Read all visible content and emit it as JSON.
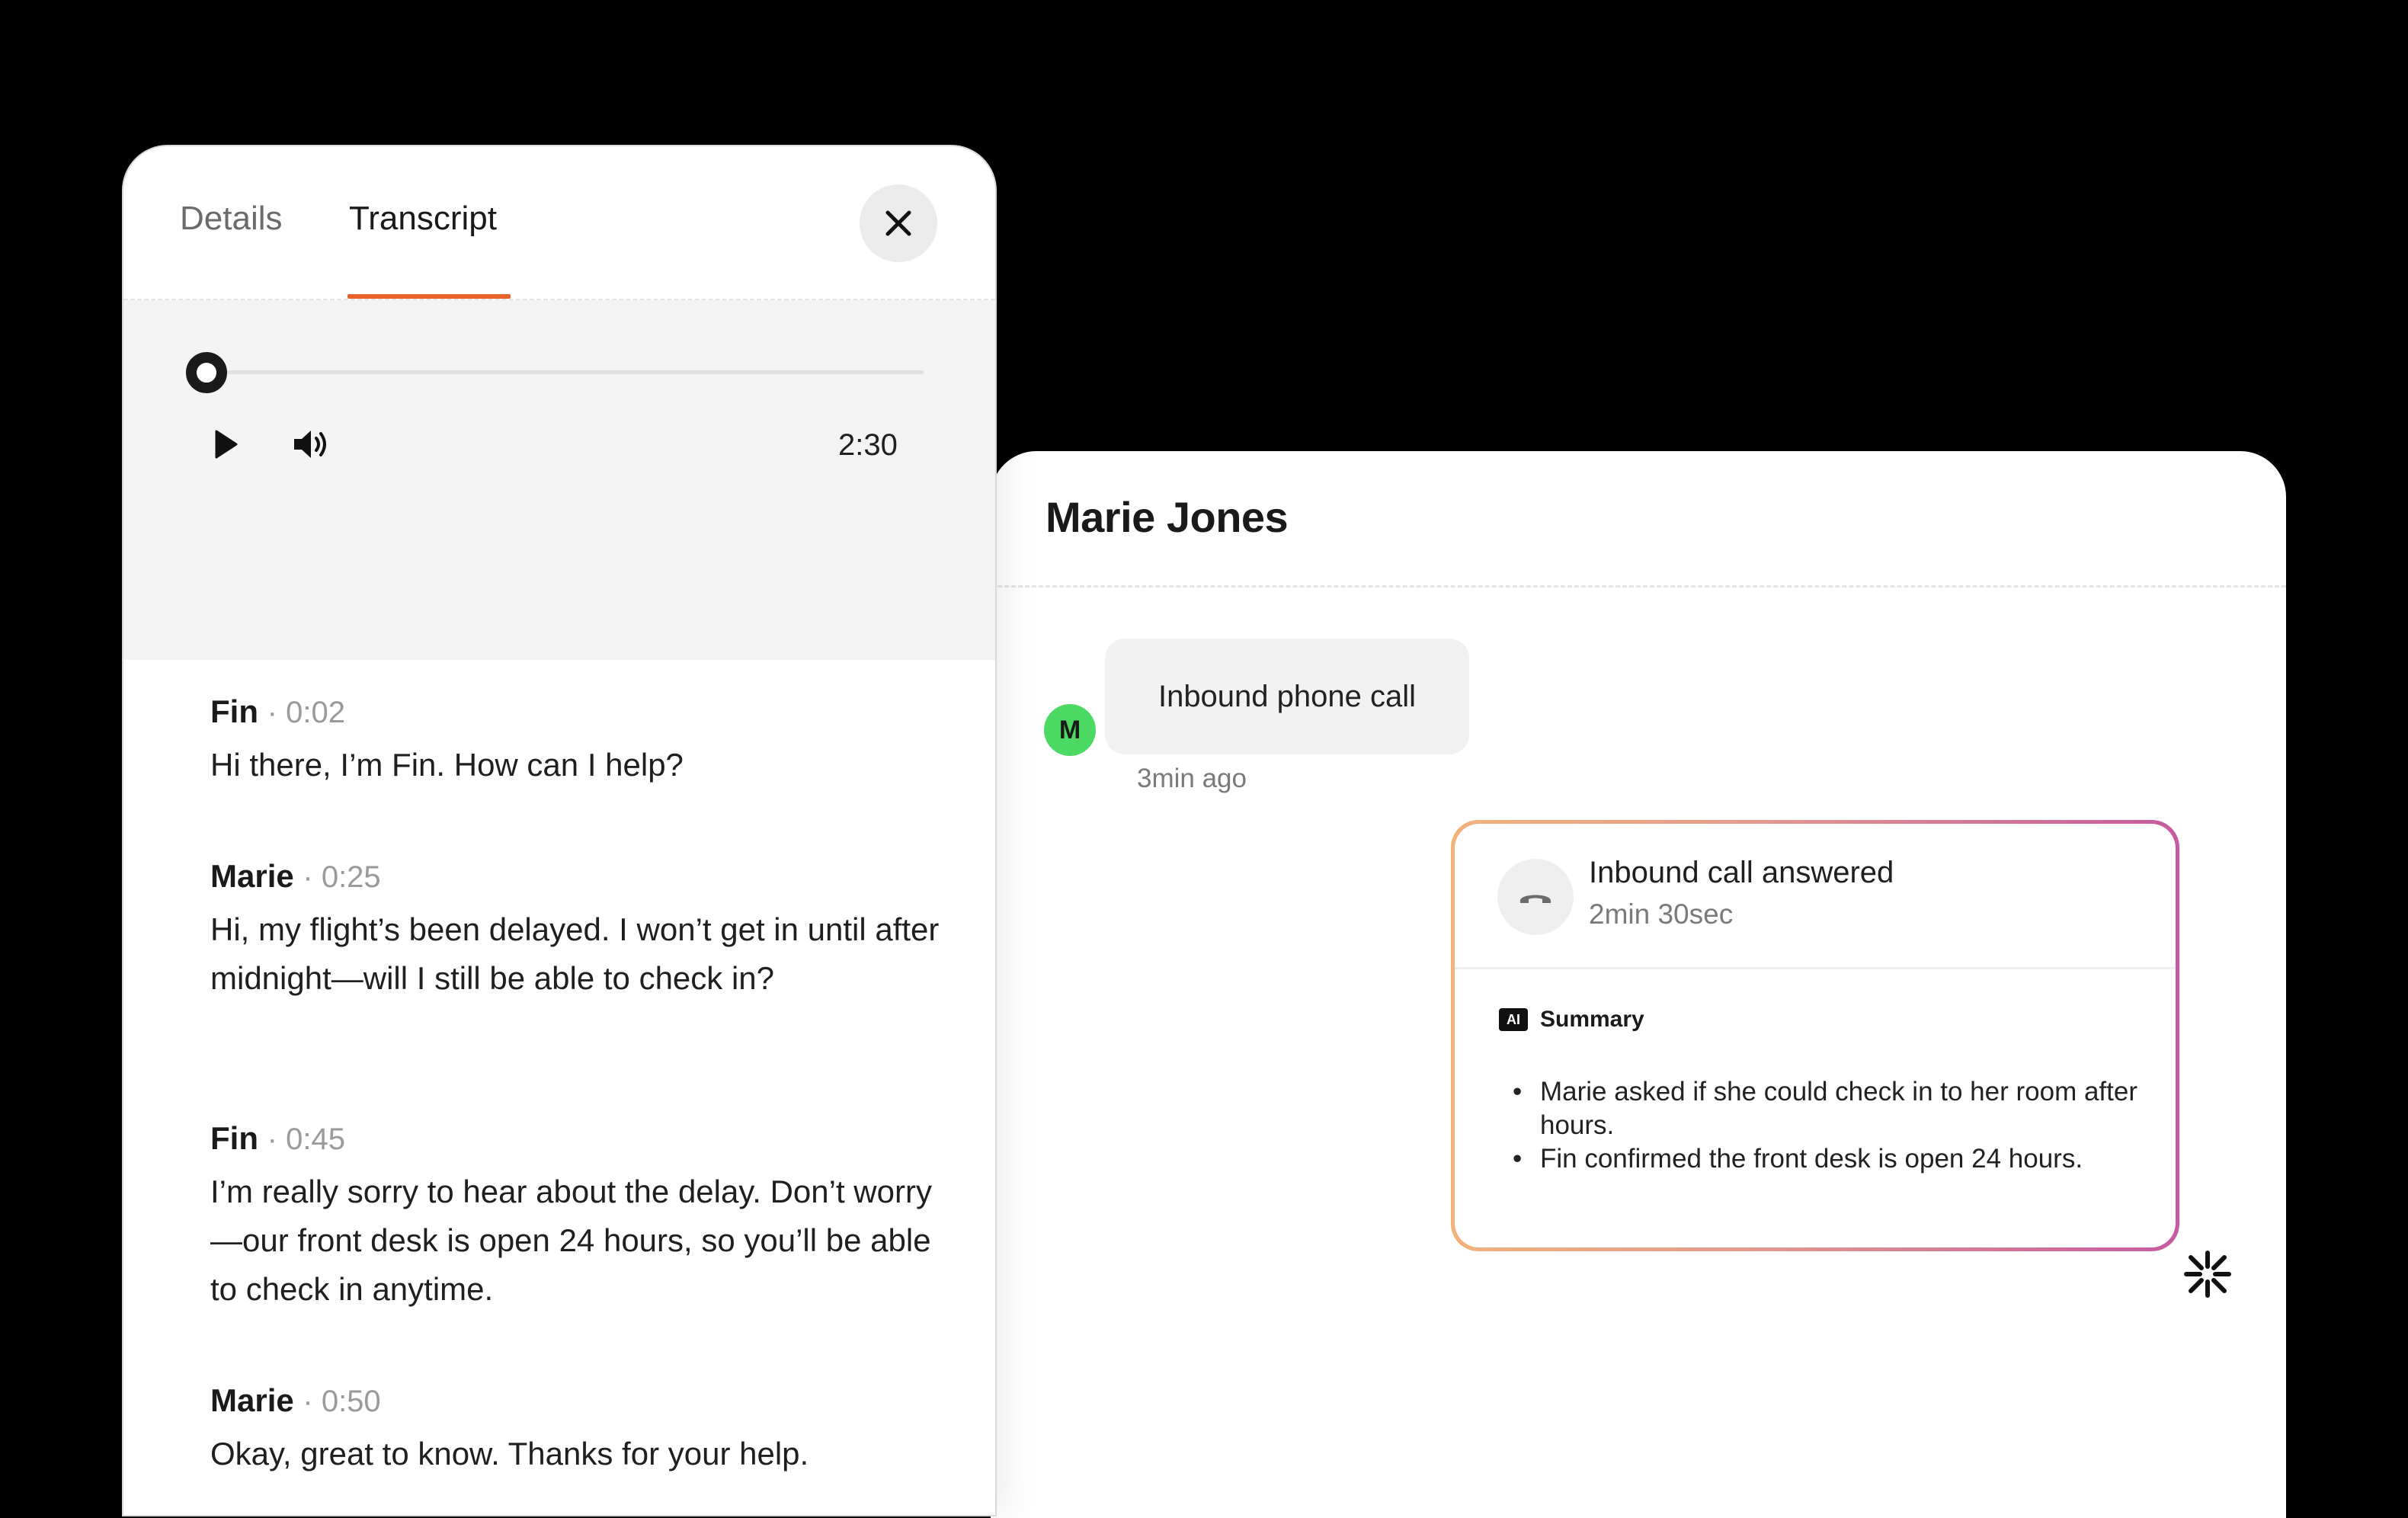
{
  "transcript_panel": {
    "tabs": [
      {
        "label": "Details"
      },
      {
        "label": "Transcript"
      }
    ],
    "player": {
      "duration": "2:30",
      "progress": 0
    },
    "messages": [
      {
        "speaker": "Fin",
        "time": "· 0:02",
        "text": "Hi there, I’m Fin. How can I help?"
      },
      {
        "speaker": "Marie",
        "time": "· 0:25",
        "text": "Hi, my flight’s been delayed. I won’t get in until after midnight—will I still be able to check in?"
      },
      {
        "speaker": "Fin",
        "time": "· 0:45",
        "text": "I’m really sorry to hear about the delay. Don’t worry—our front desk is open 24 hours, so you’ll be able to check in anytime."
      },
      {
        "speaker": "Marie",
        "time": "· 0:50",
        "text": "Okay, great to know. Thanks for your help."
      }
    ]
  },
  "conversation": {
    "title": "Marie Jones",
    "avatar_initial": "M",
    "inbound_bubble": "Inbound phone call",
    "inbound_time": "3min ago",
    "call_card": {
      "title": "Inbound call answered",
      "duration": "2min 30sec",
      "badge": "AI",
      "summary_label": "Summary",
      "summary_items": [
        "Marie asked if she could check in to her room after hours.",
        "Fin confirmed the front desk is open 24 hours."
      ]
    }
  },
  "colors": {
    "accent_tab": "#e8622a",
    "avatar": "#4cd964",
    "card_gradient_start": "#f2b27a",
    "card_gradient_end": "#c65aa0"
  },
  "icons": [
    "close-icon",
    "play-icon",
    "volume-icon",
    "phone-hangup-icon",
    "fin-logo-icon"
  ]
}
